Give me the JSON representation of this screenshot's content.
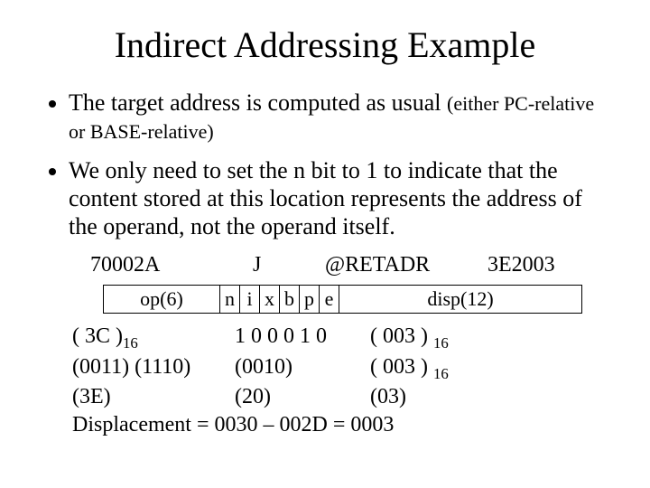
{
  "title": "Indirect Addressing Example",
  "bullets": {
    "b1_main": "The target address is computed as usual ",
    "b1_small": "(either PC-relative or BASE-relative)",
    "b2": "We only need to set the n bit to 1 to indicate that the content stored at this location represents the address of the operand, not the operand itself."
  },
  "asm": {
    "addr": "70002A",
    "mnem": "J",
    "operand": "@RETADR",
    "objcode": "3E2003"
  },
  "enc": {
    "op": "op(6)",
    "n": "n",
    "i": "i",
    "x": "x",
    "b": "b",
    "p": "p",
    "e": "e",
    "disp": "disp(12)"
  },
  "work": {
    "r1c1_a": "( 3C )",
    "r1c1_sub": "16",
    "r1c2": "1 0 0 0 1 0",
    "r1c3_a": "( 003 ) ",
    "r1c3_sub": "16",
    "r2c1": "(0011) (1110)",
    "r2c2": "(0010)",
    "r2c3_a": "( 003 ) ",
    "r2c3_sub": "16",
    "r3c1": "(3E)",
    "r3c2": "(20)",
    "r3c3": "(03)",
    "displacement": "Displacement = 0030 – 002D = 0003"
  }
}
